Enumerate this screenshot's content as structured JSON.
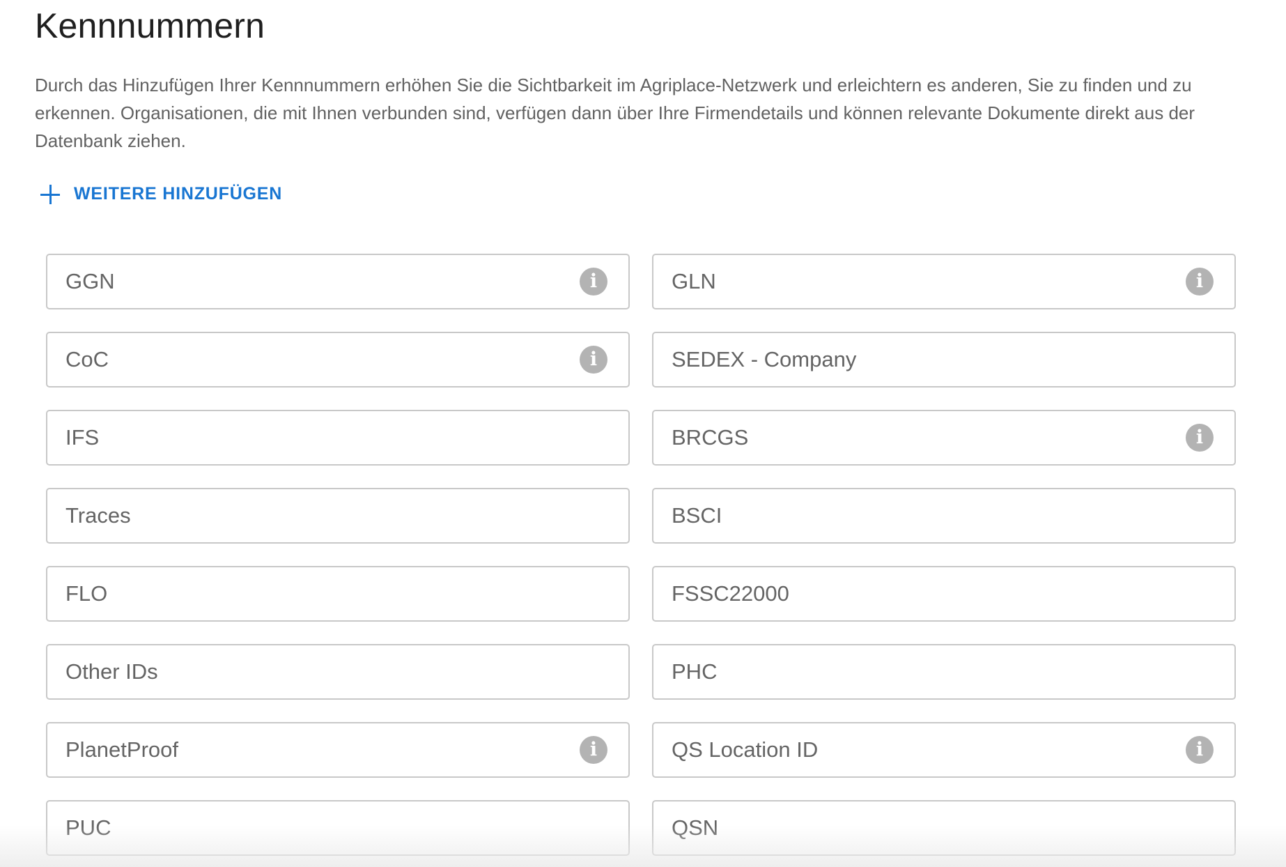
{
  "header": {
    "title": "Kennnummern",
    "description": "Durch das Hinzufügen Ihrer Kennnummern erhöhen Sie die Sichtbarkeit im Agriplace-Netzwerk und erleichtern es anderen, Sie zu finden und zu erkennen. Organisationen, die mit Ihnen verbunden sind, verfügen dann über Ihre Firmendetails und können relevante Dokumente direkt aus der Datenbank ziehen."
  },
  "actions": {
    "add_more_label": "WEITERE HINZUFÜGEN",
    "add_more_icon": "plus-icon",
    "accent_color": "#1976d2"
  },
  "fields": [
    {
      "id": "ggn",
      "placeholder": "GGN",
      "value": "",
      "info": true
    },
    {
      "id": "gln",
      "placeholder": "GLN",
      "value": "",
      "info": true
    },
    {
      "id": "coc",
      "placeholder": "CoC",
      "value": "",
      "info": true
    },
    {
      "id": "sedex-company",
      "placeholder": "SEDEX - Company",
      "value": "",
      "info": false
    },
    {
      "id": "ifs",
      "placeholder": "IFS",
      "value": "",
      "info": false
    },
    {
      "id": "brcgs",
      "placeholder": "BRCGS",
      "value": "",
      "info": true
    },
    {
      "id": "traces",
      "placeholder": "Traces",
      "value": "",
      "info": false
    },
    {
      "id": "bsci",
      "placeholder": "BSCI",
      "value": "",
      "info": false
    },
    {
      "id": "flo",
      "placeholder": "FLO",
      "value": "",
      "info": false
    },
    {
      "id": "fssc22000",
      "placeholder": "FSSC22000",
      "value": "",
      "info": false
    },
    {
      "id": "other-ids",
      "placeholder": "Other IDs",
      "value": "",
      "info": false
    },
    {
      "id": "phc",
      "placeholder": "PHC",
      "value": "",
      "info": false
    },
    {
      "id": "planetproof",
      "placeholder": "PlanetProof",
      "value": "",
      "info": true
    },
    {
      "id": "qs-location-id",
      "placeholder": "QS Location ID",
      "value": "",
      "info": true
    },
    {
      "id": "puc",
      "placeholder": "PUC",
      "value": "",
      "info": false
    },
    {
      "id": "qsn",
      "placeholder": "QSN",
      "value": "",
      "info": false
    }
  ],
  "info_icon": {
    "name": "info-icon",
    "glyph": "i",
    "color": "#b3b3b3"
  }
}
